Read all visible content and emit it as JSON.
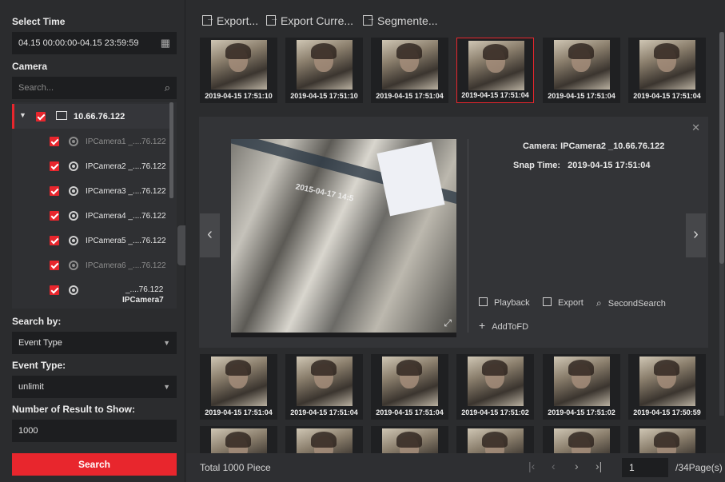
{
  "left": {
    "select_time_label": "Select Time",
    "time_range": "04.15 00:00:00-04.15 23:59:59",
    "camera_label": "Camera",
    "search_placeholder": "Search...",
    "tree": {
      "root": "10.66.76.122",
      "cameras": [
        {
          "name": "IPCamera1 _....76.122",
          "online": false
        },
        {
          "name": "IPCamera2 _....76.122",
          "online": true
        },
        {
          "name": "IPCamera3 _....76.122",
          "online": true
        },
        {
          "name": "IPCamera4 _....76.122",
          "online": true
        },
        {
          "name": "IPCamera5 _....76.122",
          "online": true
        },
        {
          "name": "IPCamera6 _....76.122",
          "online": false
        },
        {
          "name": "_....76.122",
          "name2": "IPCamera7",
          "online": true
        }
      ]
    },
    "search_by_label": "Search by:",
    "search_by_value": "Event Type",
    "event_type_label": "Event Type:",
    "event_type_value": "unlimit",
    "num_results_label": "Number of Result to Show:",
    "num_results_value": "1000",
    "search_button": "Search"
  },
  "toolbar": {
    "export": "Export...",
    "export_current": "Export Curre...",
    "segmented": "Segmente..."
  },
  "thumbs_top": [
    "2019-04-15 17:51:10",
    "2019-04-15 17:51:10",
    "2019-04-15 17:51:04",
    "2019-04-15 17:51:04",
    "2019-04-15 17:51:04",
    "2019-04-15 17:51:04"
  ],
  "thumbs_bottom": [
    "2019-04-15 17:51:04",
    "2019-04-15 17:51:04",
    "2019-04-15 17:51:04",
    "2019-04-15 17:51:02",
    "2019-04-15 17:51:02",
    "2019-04-15 17:50:59"
  ],
  "detail": {
    "camera_label": "Camera:",
    "camera_value": "IPCamera2 _10.66.76.122",
    "snap_label": "Snap Time:",
    "snap_value": "2019-04-15 17:51:04",
    "overlay_text": "2015-04-17 14:5",
    "actions": {
      "playback": "Playback",
      "export": "Export",
      "second_search": "SecondSearch",
      "add_to_fd": "AddToFD"
    }
  },
  "footer": {
    "total": "Total 1000 Piece",
    "page": "1",
    "page_total": "/34Page(s)"
  },
  "colors": {
    "accent": "#e8262d",
    "background": "#2b2c2e"
  },
  "icons": [
    "calendar-icon",
    "search-icon",
    "folder-icon",
    "camera-icon",
    "chevron-down-icon",
    "export-icon",
    "close-icon",
    "chevron-left-icon",
    "chevron-right-icon",
    "playback-icon",
    "second-search-icon",
    "add-icon",
    "expand-icon"
  ]
}
